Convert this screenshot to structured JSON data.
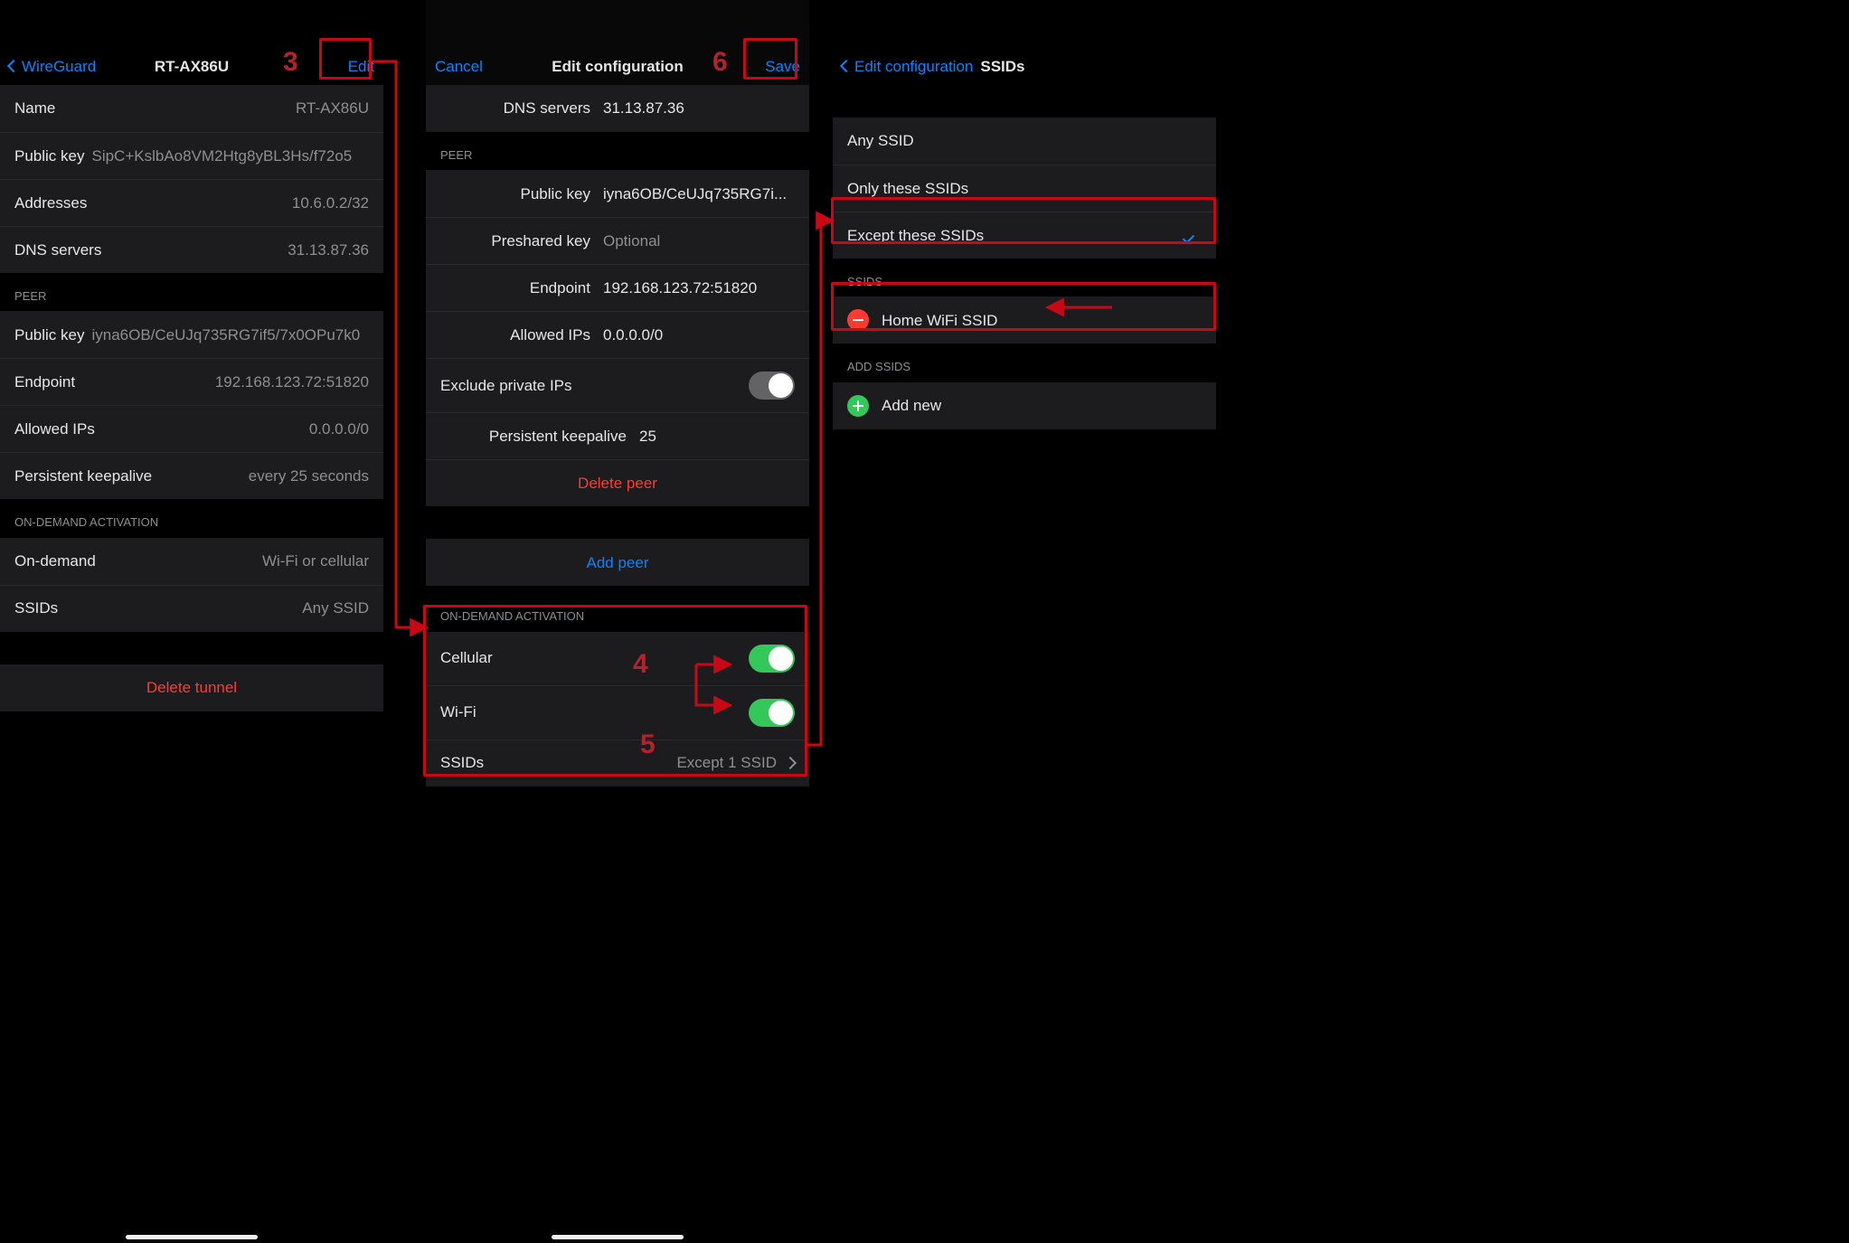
{
  "steps": {
    "s3": "3",
    "s4": "4",
    "s5": "5",
    "s6": "6"
  },
  "p1": {
    "nav": {
      "back": "WireGuard",
      "title": "RT-AX86U",
      "right": "Edit"
    },
    "interface": {
      "name_label": "Name",
      "name_value": "RT-AX86U",
      "pubkey_label": "Public key",
      "pubkey_value": "SipC+KslbAo8VM2Htg8yBL3Hs/f72o5",
      "addr_label": "Addresses",
      "addr_value": "10.6.0.2/32",
      "dns_label": "DNS servers",
      "dns_value": "31.13.87.36"
    },
    "peer_header": "PEER",
    "peer": {
      "pubkey_label": "Public key",
      "pubkey_value": "iyna6OB/CeUJq735RG7if5/7x0OPu7k0",
      "endpoint_label": "Endpoint",
      "endpoint_value": "192.168.123.72:51820",
      "allowed_label": "Allowed IPs",
      "allowed_value": "0.0.0.0/0",
      "keepalive_label": "Persistent keepalive",
      "keepalive_value": "every 25 seconds"
    },
    "oda_header": "ON-DEMAND ACTIVATION",
    "oda": {
      "ondemand_label": "On-demand",
      "ondemand_value": "Wi-Fi or cellular",
      "ssids_label": "SSIDs",
      "ssids_value": "Any SSID"
    },
    "delete": "Delete tunnel"
  },
  "p2": {
    "nav": {
      "left": "Cancel",
      "title": "Edit configuration",
      "right": "Save"
    },
    "interface": {
      "dns_label": "DNS servers",
      "dns_value": "31.13.87.36"
    },
    "peer_header": "PEER",
    "peer": {
      "pubkey_label": "Public key",
      "pubkey_value": "iyna6OB/CeUJq735RG7i...",
      "psk_label": "Preshared key",
      "psk_placeholder": "Optional",
      "endpoint_label": "Endpoint",
      "endpoint_value": "192.168.123.72:51820",
      "allowed_label": "Allowed IPs",
      "allowed_value": "0.0.0.0/0",
      "exclude_label": "Exclude private IPs",
      "keepalive_label": "Persistent keepalive",
      "keepalive_value": "25"
    },
    "delete_peer": "Delete peer",
    "add_peer": "Add peer",
    "oda_header": "ON-DEMAND ACTIVATION",
    "oda": {
      "cellular_label": "Cellular",
      "wifi_label": "Wi-Fi",
      "ssids_label": "SSIDs",
      "ssids_value": "Except 1 SSID"
    }
  },
  "p3": {
    "nav": {
      "back": "Edit configuration",
      "title": "SSIDs"
    },
    "options": {
      "any": "Any SSID",
      "only": "Only these SSIDs",
      "except": "Except these SSIDs"
    },
    "ssids_header": "SSIDS",
    "ssid_item": "Home WiFi SSID",
    "add_header": "ADD SSIDS",
    "add_new": "Add new"
  }
}
